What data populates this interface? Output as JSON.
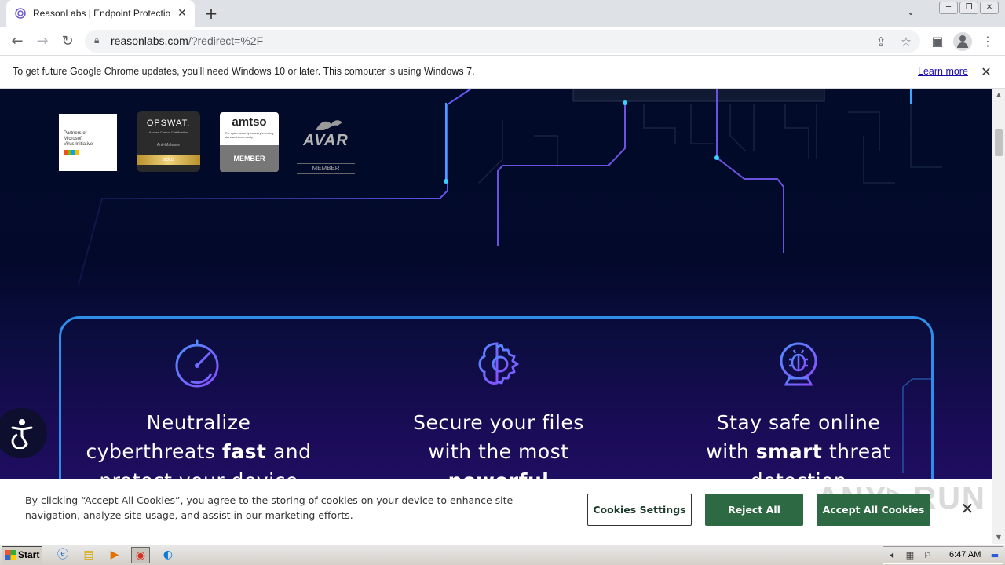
{
  "browser": {
    "tab_title": "ReasonLabs | Endpoint Protection &",
    "url_host": "reasonlabs.com",
    "url_path": "/?redirect=%2F",
    "window_controls": [
      "─",
      "❐",
      "✕"
    ]
  },
  "infobar": {
    "message": "To get future Google Chrome updates, you'll need Windows 10 or later. This computer is using Windows 7.",
    "link": "Learn more"
  },
  "badges": {
    "microsoft": [
      "Partners of",
      "Microsoft",
      "Virus Initiative",
      "Microsoft"
    ],
    "opswat": {
      "title": "OPSWAT.",
      "subtitle": "Access Control Certification",
      "category": "Anti-Malware",
      "level": "GOLD"
    },
    "amtso": {
      "title": "amtso",
      "tagline": "The cybersecurity industry's testing standard community",
      "status": "MEMBER"
    },
    "avar": {
      "title": "AVAR",
      "status": "MEMBER"
    }
  },
  "features": [
    {
      "line1": "Neutralize",
      "line2_pre": "cyberthreats ",
      "line2_bold": "fast",
      "line2_post": " and",
      "line3": "protect your device"
    },
    {
      "line1": "Secure your files",
      "line2_pre": "with the most",
      "line2_bold": "",
      "line2_post": "",
      "line3": "powerful"
    },
    {
      "line1": "Stay safe online",
      "line2_pre": "with ",
      "line2_bold": "smart",
      "line2_post": " threat",
      "line3": "detection"
    }
  ],
  "cookie": {
    "text": "By clicking “Accept All Cookies”, you agree to the storing of cookies on your device to enhance site navigation, analyze site usage, and assist in our marketing efforts.",
    "settings": "Cookies Settings",
    "reject": "Reject All",
    "accept": "Accept All Cookies",
    "watermark": "ANY▷RUN"
  },
  "taskbar": {
    "start": "Start",
    "clock": "6:47 AM"
  },
  "colors": {
    "feature_border": "#2e8ee8",
    "cookie_button": "#2d6a44",
    "page_bg_top": "#020b2a",
    "page_bg_bottom": "#25106b"
  }
}
